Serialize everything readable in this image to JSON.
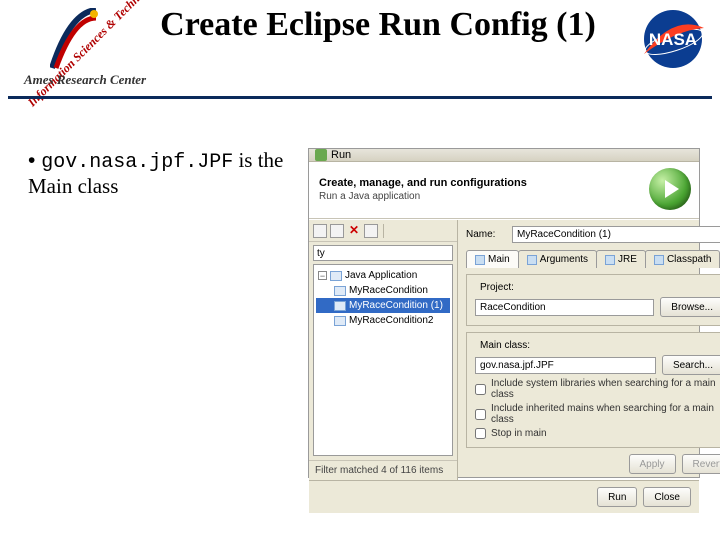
{
  "slide": {
    "title": "Create Eclipse Run Config (1)",
    "arc_tagline": "Information Sciences & Technology",
    "arc_name": "Ames Research Center",
    "nasa_word": "NASA"
  },
  "bullet": {
    "prefix": "• ",
    "code": "gov.nasa.jpf.JPF",
    "rest": " is the Main class"
  },
  "dlg": {
    "title": "Run",
    "banner_h": "Create, manage, and run configurations",
    "banner_s": "Run a Java application",
    "filter_value": "ty",
    "tree": {
      "root": "Java Application",
      "children": [
        "MyRaceCondition",
        "MyRaceCondition (1)",
        "MyRaceCondition2"
      ]
    },
    "status": "Filter matched 4 of 116 items",
    "name_label": "Name:",
    "name_value": "MyRaceCondition (1)",
    "tabs": [
      "Main",
      "Arguments",
      "JRE",
      "Classpath"
    ],
    "tabmore": "»",
    "project_label": "Project:",
    "project_value": "RaceCondition",
    "browse": "Browse...",
    "main_label": "Main class:",
    "main_value": "gov.nasa.jpf.JPF",
    "search": "Search...",
    "chk1": "Include system libraries when searching for a main class",
    "chk2": "Include inherited mains when searching for a main class",
    "chk3": "Stop in main",
    "apply": "Apply",
    "revert": "Revert",
    "run": "Run",
    "close": "Close"
  }
}
